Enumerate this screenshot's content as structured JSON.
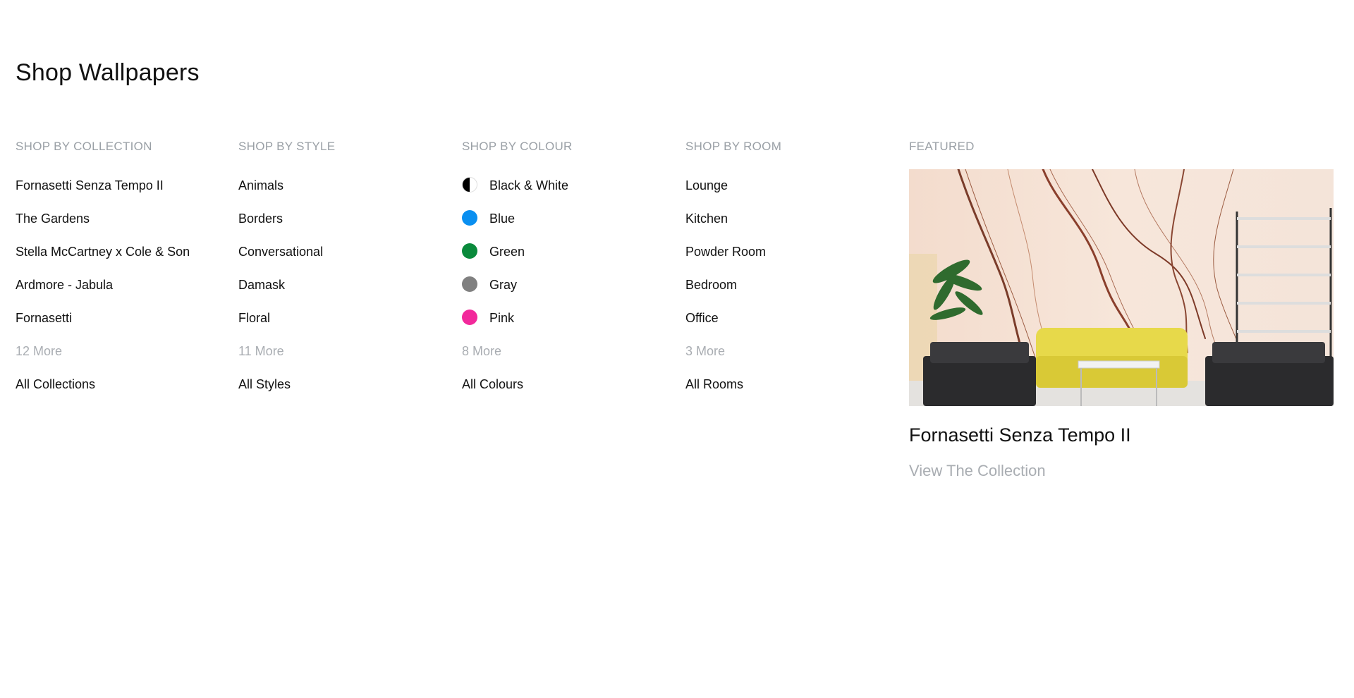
{
  "page": {
    "title": "Shop Wallpapers"
  },
  "columns": [
    {
      "heading": "SHOP BY COLLECTION",
      "items": [
        "Fornasetti Senza Tempo II",
        "The Gardens",
        "Stella McCartney x Cole & Son",
        "Ardmore - Jabula",
        "Fornasetti"
      ],
      "more": "12 More",
      "all": "All Collections"
    },
    {
      "heading": "SHOP BY STYLE",
      "items": [
        "Animals",
        "Borders",
        "Conversational",
        "Damask",
        "Floral"
      ],
      "more": "11 More",
      "all": "All Styles"
    },
    {
      "heading": "SHOP BY COLOUR",
      "items": [
        "Black & White",
        "Blue",
        "Green",
        "Gray",
        "Pink"
      ],
      "swatches": [
        "bw",
        "#0a8ff0",
        "#0a8a3c",
        "#808080",
        "#f2299b"
      ],
      "more": "8 More",
      "all": "All Colours"
    },
    {
      "heading": "SHOP BY ROOM",
      "items": [
        "Lounge",
        "Kitchen",
        "Powder Room",
        "Bedroom",
        "Office"
      ],
      "more": "3 More",
      "all": "All Rooms"
    }
  ],
  "featured": {
    "heading": "FEATURED",
    "title": "Fornasetti Senza Tempo II",
    "link": "View The Collection"
  }
}
